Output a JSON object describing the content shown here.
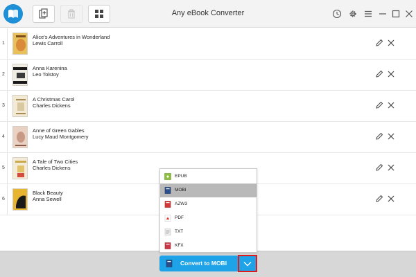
{
  "window": {
    "title": "Any eBook Converter"
  },
  "toolbar": {
    "add_icon": "add-file-icon",
    "delete_icon": "trash-icon",
    "view_icon": "grid-view-icon"
  },
  "window_controls": [
    "history-icon",
    "gear-icon",
    "menu-icon",
    "minimize-icon",
    "maximize-icon",
    "close-icon"
  ],
  "books": [
    {
      "index": "1",
      "title": "Alice's Adventures in Wonderland",
      "author": "Lewis Carroll"
    },
    {
      "index": "2",
      "title": "Anna Karenina",
      "author": "Leo Tolstoy"
    },
    {
      "index": "3",
      "title": "A Christmas Carol",
      "author": "Charles Dickens"
    },
    {
      "index": "4",
      "title": "Anne of Green Gables",
      "author": "Lucy Maud Montgomery"
    },
    {
      "index": "5",
      "title": "A Tale of Two Cities",
      "author": "Charles Dickens"
    },
    {
      "index": "6",
      "title": "Black Beauty",
      "author": "Anna Sewell"
    }
  ],
  "format_menu": {
    "items": [
      {
        "label": "EPUB",
        "selected": false
      },
      {
        "label": "MOBI",
        "selected": true
      },
      {
        "label": "AZW3",
        "selected": false
      },
      {
        "label": "PDF",
        "selected": false
      },
      {
        "label": "TXT",
        "selected": false
      },
      {
        "label": "KFX",
        "selected": false
      }
    ]
  },
  "footer": {
    "convert_label": "Convert to MOBI"
  },
  "colors": {
    "accent": "#1fa3e8",
    "highlight_border": "#e11b1b",
    "selected_item": "#b9b9b9"
  }
}
